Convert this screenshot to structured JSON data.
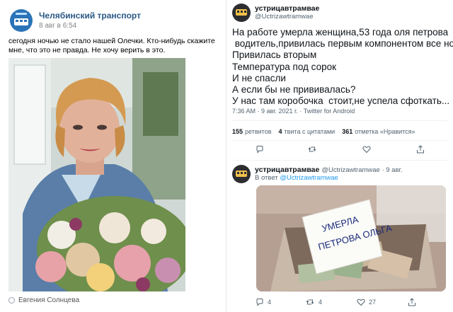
{
  "vk_post": {
    "group_name": "Челябинский транспорт",
    "date": "8 авг в 6:54",
    "text": "сегодня ночью не стало нашей Олечки. Кто-нибудь скажите мне, что это не правда. Не хочу верить в это.",
    "photo_author": "Евгения Солнцева"
  },
  "tweet_main": {
    "display_name": "устрицавтрамвае",
    "handle": "@Uctrizawtramwae",
    "lines": [
      "На работе умерла женщина,53 года оля петрова",
      " водитель,привилась первым компонентом все норм",
      "Привилась вторым",
      "Температура под сорок",
      "И не спасли",
      "А если бы не прививалась?",
      "У нас там коробочка  стоит,не успела сфоткать..."
    ],
    "meta": "7:36 AM · 9 авг. 2021 г. · Twitter for Android",
    "stats": {
      "retweets_count": "155",
      "retweets_label": "ретвитов",
      "quotes_count": "4",
      "quotes_label": "твита с цитатами",
      "likes_count": "361",
      "likes_label": "отметка «Нравится»"
    }
  },
  "tweet_reply": {
    "display_name": "устрицавтрамвае",
    "handle_date": "@Uctrizawtramwae · 9 авг.",
    "reply_prefix": "В ответ",
    "reply_to": "@Uctrizawtramwae",
    "photo_note_line1": "УМЕРЛА",
    "photo_note_line2": "ПЕТРОВА ОЛЬГА",
    "actions": {
      "reply_count": "4",
      "retweet_count": "4",
      "like_count": "27"
    }
  },
  "colors": {
    "link_blue": "#2a5885",
    "twitter_blue": "#1d9bf0",
    "muted": "#536471"
  },
  "icons": [
    "bus-logo-icon",
    "tram-avatar-icon",
    "reply-icon",
    "retweet-icon",
    "like-icon",
    "share-icon",
    "author-pin-icon"
  ]
}
